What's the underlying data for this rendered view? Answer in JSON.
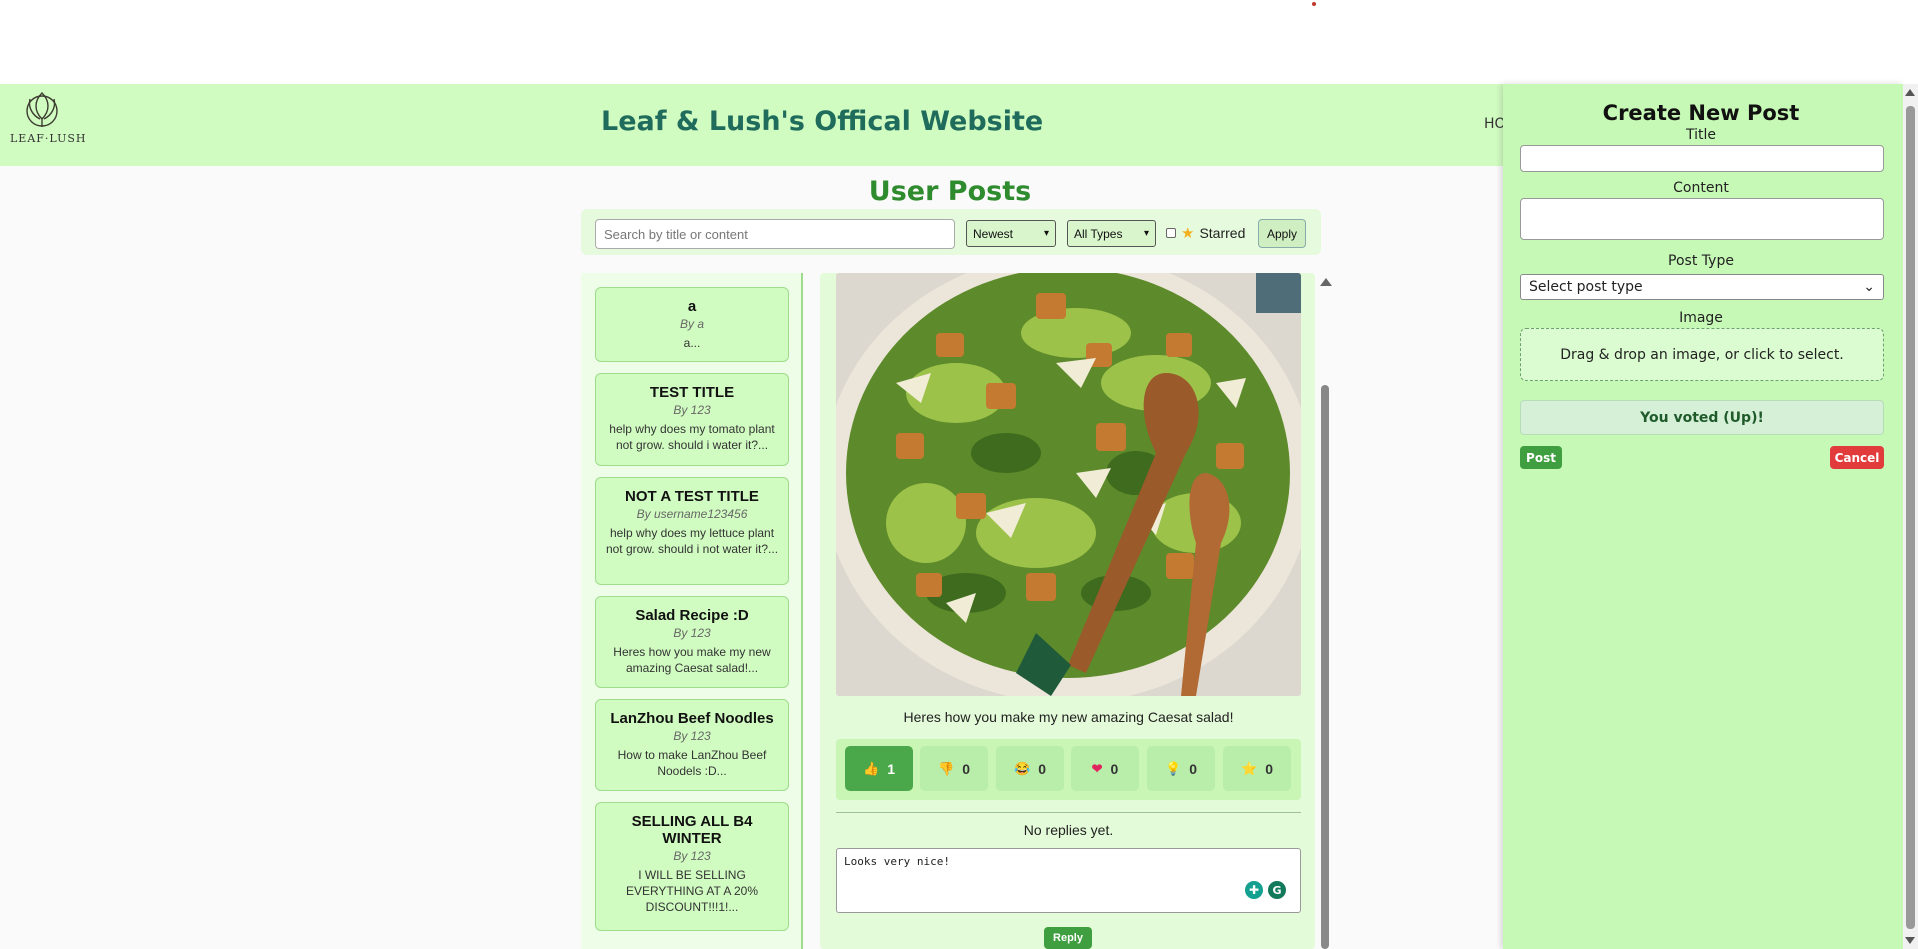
{
  "header": {
    "logo_text": "LEAF·LUSH",
    "site_title": "Leaf & Lush's Offical Website",
    "nav_partial": "HO"
  },
  "page_title": "User Posts",
  "filters": {
    "search_placeholder": "Search by title or content",
    "sort_selected": "Newest",
    "type_selected": "All Types",
    "starred_label": "Starred",
    "starred_checked": false,
    "apply_label": "Apply"
  },
  "posts": [
    {
      "title": "a",
      "author": "By a",
      "excerpt": "a..."
    },
    {
      "title": "TEST TITLE",
      "author": "By 123",
      "excerpt": "help why does my tomato plant not grow. should i water it?..."
    },
    {
      "title": "NOT A TEST TITLE",
      "author": "By username123456",
      "excerpt": "help why does my lettuce plant not grow. should i not water it?..."
    },
    {
      "title": "Salad Recipe :D",
      "author": "By 123",
      "excerpt": "Heres how you make my new amazing Caesat salad!..."
    },
    {
      "title": "LanZhou Beef Noodles",
      "author": "By 123",
      "excerpt": "How to make LanZhou Beef Noodels :D..."
    },
    {
      "title": "SELLING ALL B4 WINTER",
      "author": "By 123",
      "excerpt": "I WILL BE SELLING EVERYTHING AT A 20% DISCOUNT!!!1!..."
    }
  ],
  "detail": {
    "image_alt": "salad-photo",
    "body": "Heres how you make my new amazing Caesat salad!",
    "reactions": [
      {
        "icon": "👍",
        "count": "1",
        "active": true
      },
      {
        "icon": "👎",
        "count": "0",
        "active": false
      },
      {
        "icon": "😂",
        "count": "0",
        "active": false
      },
      {
        "icon": "❤",
        "count": "0",
        "active": false
      },
      {
        "icon": "💡",
        "count": "0",
        "active": false
      },
      {
        "icon": "⭐",
        "count": "0",
        "active": false
      }
    ],
    "no_replies": "No replies yet.",
    "reply_value": "Looks very nice!",
    "reply_button": "Reply"
  },
  "create_panel": {
    "title": "Create New Post",
    "title_label": "Title",
    "content_label": "Content",
    "type_label": "Post Type",
    "type_placeholder": "Select post type",
    "image_label": "Image",
    "dropzone_text": "Drag & drop an image, or click to select.",
    "vote_message": "You voted (Up)!",
    "post_button": "Post",
    "cancel_button": "Cancel"
  }
}
